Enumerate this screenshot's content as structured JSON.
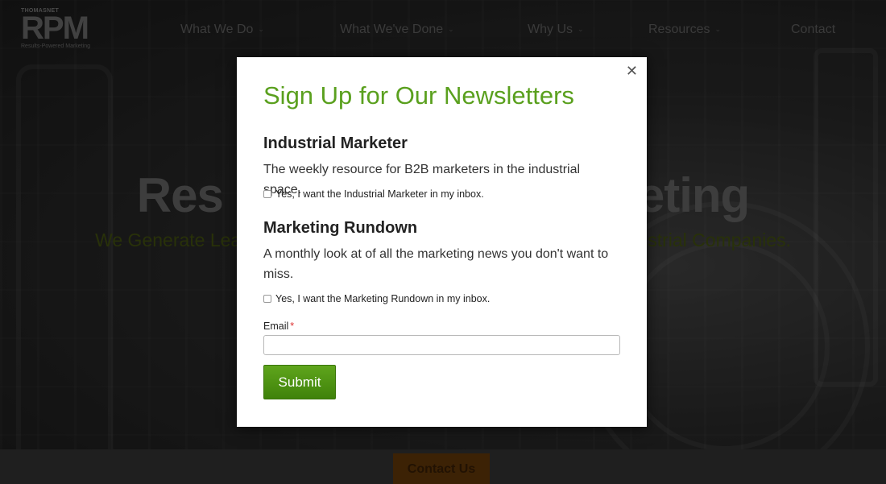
{
  "logo": {
    "brand_small": "THOMASNET",
    "brand_big": "RPM",
    "tagline": "Results-Powered Marketing"
  },
  "nav": {
    "items": [
      {
        "label": "What We Do",
        "dropdown": true
      },
      {
        "label": "What We've Done",
        "dropdown": true
      },
      {
        "label": "Why Us",
        "dropdown": true
      },
      {
        "label": "Resources",
        "dropdown": true
      },
      {
        "label": "Contact",
        "dropdown": false
      }
    ],
    "chevron_icon": "chevron-down-icon"
  },
  "hero": {
    "title_left": "Res",
    "title_right": "eting",
    "subtitle_left": "We Generate Lea",
    "subtitle_right": "strial Companies."
  },
  "footer": {
    "contact_button": "Contact Us"
  },
  "modal": {
    "close_icon": "close-icon",
    "close_glyph": "✕",
    "title": "Sign Up for Our Newsletters",
    "newsletters": [
      {
        "heading": "Industrial Marketer",
        "description": "The weekly resource for B2B marketers in the industrial space.",
        "checkbox_label": "Yes, I want the Industrial Marketer in my inbox.",
        "checked": false
      },
      {
        "heading": "Marketing Rundown",
        "description": "A monthly look at of all the marketing news you don't want to miss.",
        "checkbox_label": "Yes, I want the Marketing Rundown in my inbox.",
        "checked": false
      }
    ],
    "email_label": "Email",
    "required_marker": "*",
    "email_value": "",
    "submit_label": "Submit"
  },
  "colors": {
    "title_green": "#5aa01e",
    "button_green": "#4f9413",
    "contact_orange": "#6e3f0a"
  }
}
